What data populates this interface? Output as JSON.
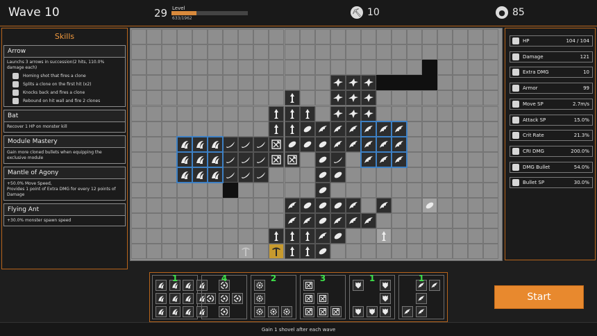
{
  "header": {
    "wave": "Wave 10",
    "level": "29",
    "level_label": "Level",
    "xp": "633/1962",
    "xp_fraction": 0.323,
    "shovels": "10",
    "shovel_icon": "pickaxe-icon",
    "bullets": "85",
    "bullet_icon": "bullet-icon"
  },
  "skills": {
    "title": "Skills",
    "items": [
      {
        "name": "Arrow",
        "desc": "Launchs 3 arrows in succession(2 hits, 110.0% damage each)",
        "subs": [
          "Homing shot that fires a clone",
          "Splits a clone on the first hit (x2)",
          "Knocks back and fires a clone",
          "Rebound on hit wall and fire 2 clones"
        ]
      },
      {
        "name": "Bat",
        "desc": "Recover 1 HP on monster kill",
        "subs": []
      },
      {
        "name": "Module Mastery",
        "desc": "Gain more cloned bullets when equipping the exclusive module",
        "subs": []
      },
      {
        "name": "Mantle of Agony",
        "desc": "+50.0% Move Speed,\nProvides 1 point of Extra DMG for every 12 points of Damage",
        "subs": []
      },
      {
        "name": "Flying Ant",
        "desc": "+30.0% monster spawn speed",
        "subs": []
      }
    ]
  },
  "stats": [
    {
      "label": "HP",
      "value": "104 / 104",
      "icon": "bullet-icon"
    },
    {
      "label": "Damage",
      "value": "121",
      "icon": "sword-icon"
    },
    {
      "label": "Extra DMG",
      "value": "10",
      "icon": "double-sword-icon"
    },
    {
      "label": "Armor",
      "value": "99",
      "icon": "armor-icon"
    },
    {
      "label": "Move SP",
      "value": "2.7m/s",
      "icon": "boot-icon"
    },
    {
      "label": "Attack SP",
      "value": "15.0%",
      "icon": "bow-icon"
    },
    {
      "label": "Crit Rate",
      "value": "21.3%",
      "icon": "crit-icon"
    },
    {
      "label": "CRI DMG",
      "value": "200.0%",
      "icon": "flame-icon"
    },
    {
      "label": "DMG Bullet",
      "value": "54.0%",
      "icon": "dmg-bullet-icon"
    },
    {
      "label": "Bullet SP",
      "value": "30.0%",
      "icon": "speed-bullet-icon"
    }
  ],
  "tray": [
    {
      "count": "1",
      "icon": "claw-icon"
    },
    {
      "count": "4",
      "icon": "vortex-icon"
    },
    {
      "count": "2",
      "icon": "saw-icon"
    },
    {
      "count": "3",
      "icon": "bow-icon"
    },
    {
      "count": "1",
      "icon": "armor-icon"
    },
    {
      "count": "1",
      "icon": "wing-icon"
    }
  ],
  "start_label": "Start",
  "footer": "Gain 1 shovel after each wave",
  "colors": {
    "accent": "#e8892e",
    "border": "#b8651c",
    "highlight": "#3d80c4",
    "count": "#3ee24a"
  }
}
